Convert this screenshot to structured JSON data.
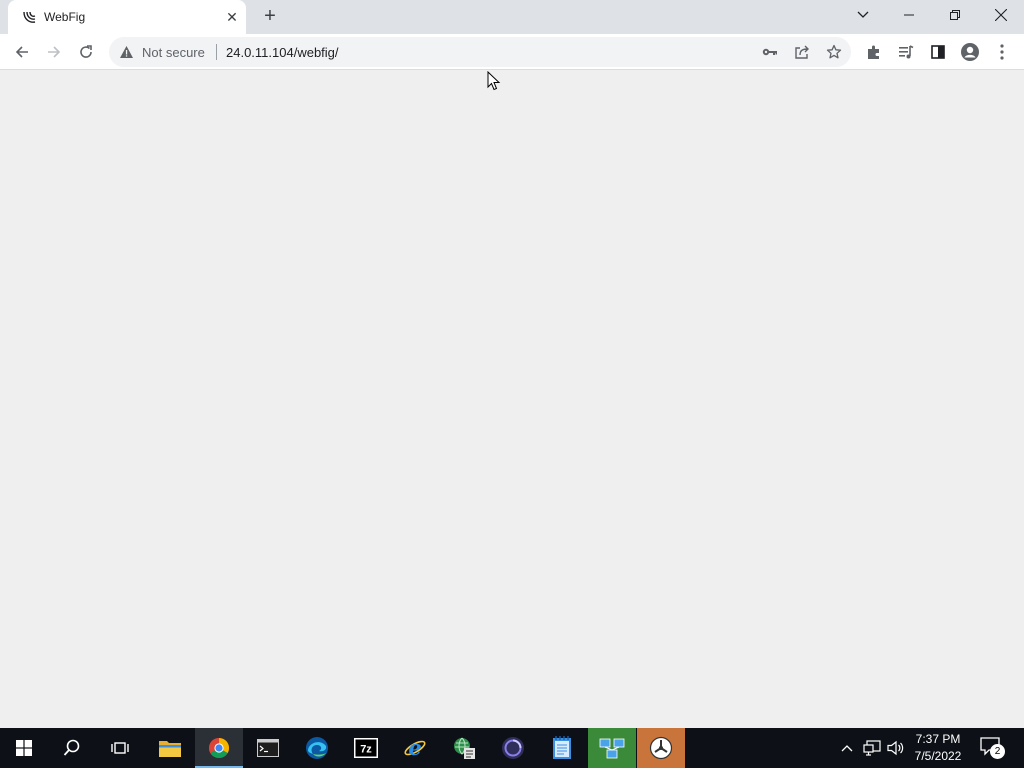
{
  "browser": {
    "tab": {
      "title": "WebFig",
      "favicon": "webfig-favicon-icon",
      "close_icon": "close-icon"
    },
    "new_tab_icon": "plus-icon",
    "window_controls": [
      "tab-search-icon",
      "minimize-icon",
      "restore-icon",
      "close-icon"
    ],
    "toolbar": {
      "back_icon": "back-arrow-icon",
      "forward_icon": "forward-arrow-icon",
      "reload_icon": "reload-icon",
      "security_label": "Not secure",
      "security_icon": "warning-triangle-icon",
      "url": "24.0.11.104/webfig/",
      "omnibox_icons": [
        "key-icon",
        "share-icon",
        "star-icon"
      ],
      "toolbar_icons": [
        "extensions-icon",
        "media-queue-icon",
        "side-panel-icon",
        "profile-icon",
        "more-vert-icon"
      ]
    }
  },
  "taskbar": {
    "apps": [
      "start-icon",
      "search-icon",
      "task-view-icon",
      "file-explorer-icon",
      "chrome-icon",
      "terminal-icon",
      "edge-icon",
      "7zip-icon",
      "internet-explorer-icon",
      "network-tool-icon",
      "obs-icon",
      "notepad-icon",
      "network-monitor-icon",
      "system-tool-icon"
    ],
    "active_app": "chrome-icon",
    "tray_icons": [
      "chevron-up-icon",
      "network-icon",
      "volume-icon"
    ],
    "clock": {
      "time": "7:37 PM",
      "date": "7/5/2022"
    },
    "notifications": {
      "count": "2"
    }
  }
}
